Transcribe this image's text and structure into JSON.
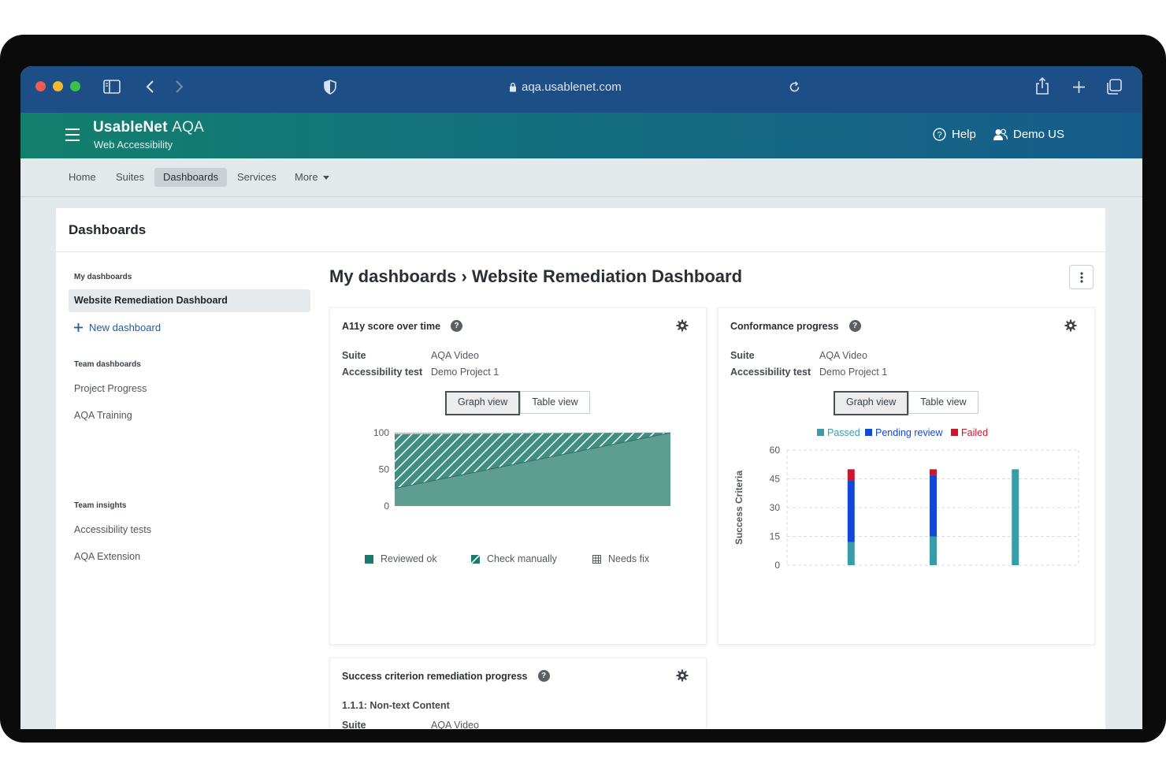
{
  "browser": {
    "url": "aqa.usablenet.com"
  },
  "app": {
    "brand_bold": "UsableNet",
    "brand_thin": "AQA",
    "subtitle": "Web Accessibility",
    "help": "Help",
    "user": "Demo US"
  },
  "nav": {
    "items": [
      "Home",
      "Suites",
      "Dashboards",
      "Services",
      "More"
    ],
    "active": "Dashboards"
  },
  "page": {
    "title": "Dashboards"
  },
  "sidebar": {
    "my_heading": "My dashboards",
    "active_item": "Website Remediation Dashboard",
    "new_dashboard": "New dashboard",
    "team_heading": "Team dashboards",
    "team_items": [
      "Project Progress",
      "AQA Training"
    ],
    "insights_heading": "Team insights",
    "insights_items": [
      "Accessibility tests",
      "AQA Extension"
    ]
  },
  "breadcrumb": "My dashboards › Website Remediation Dashboard",
  "widgets": {
    "score": {
      "title": "A11y score over time",
      "suite_label": "Suite",
      "suite_value": "AQA Video",
      "test_label": "Accessibility test",
      "test_value": "Demo Project 1",
      "graph_view": "Graph view",
      "table_view": "Table view",
      "legend": [
        "Reviewed ok",
        "Check manually",
        "Needs fix"
      ]
    },
    "conformance": {
      "title": "Conformance progress",
      "suite_label": "Suite",
      "suite_value": "AQA Video",
      "test_label": "Accessibility test",
      "test_value": "Demo Project 1",
      "graph_view": "Graph view",
      "table_view": "Table view"
    },
    "remediation": {
      "title": "Success criterion remediation progress",
      "criterion": "1.1.1: Non-text Content",
      "suite_label": "Suite",
      "suite_value": "AQA Video"
    }
  },
  "chart_data": [
    {
      "type": "area",
      "title": "A11y score over time",
      "xlabel": "",
      "ylabel": "",
      "x": [
        0,
        1
      ],
      "series": [
        {
          "name": "Reviewed ok",
          "values": [
            24,
            100
          ]
        },
        {
          "name": "Check manually",
          "values": [
            74,
            0
          ]
        },
        {
          "name": "Needs fix",
          "values": [
            2,
            0
          ]
        }
      ],
      "ylim": [
        0,
        100
      ],
      "yticks": [
        0,
        50,
        100
      ],
      "colors": {
        "Reviewed ok": "#5e9e91",
        "Check manually": "#3f8f80",
        "Needs fix": "#cfd8d6"
      },
      "legend_position": "bottom",
      "grid": false
    },
    {
      "type": "bar",
      "stacked": true,
      "title": "Conformance progress",
      "xlabel": "",
      "ylabel": "Success Criteria",
      "categories": [
        "",
        "",
        ""
      ],
      "series": [
        {
          "name": "Passed",
          "values": [
            12,
            15,
            50
          ]
        },
        {
          "name": "Pending review",
          "values": [
            32,
            32,
            0
          ]
        },
        {
          "name": "Failed",
          "values": [
            6,
            3,
            0
          ]
        }
      ],
      "ylim": [
        0,
        60
      ],
      "yticks": [
        0,
        15,
        30,
        45,
        60
      ],
      "colors": {
        "Passed": "#3a9ca8",
        "Pending review": "#1347d6",
        "Failed": "#c8182b"
      },
      "legend_position": "top",
      "grid": true
    }
  ]
}
